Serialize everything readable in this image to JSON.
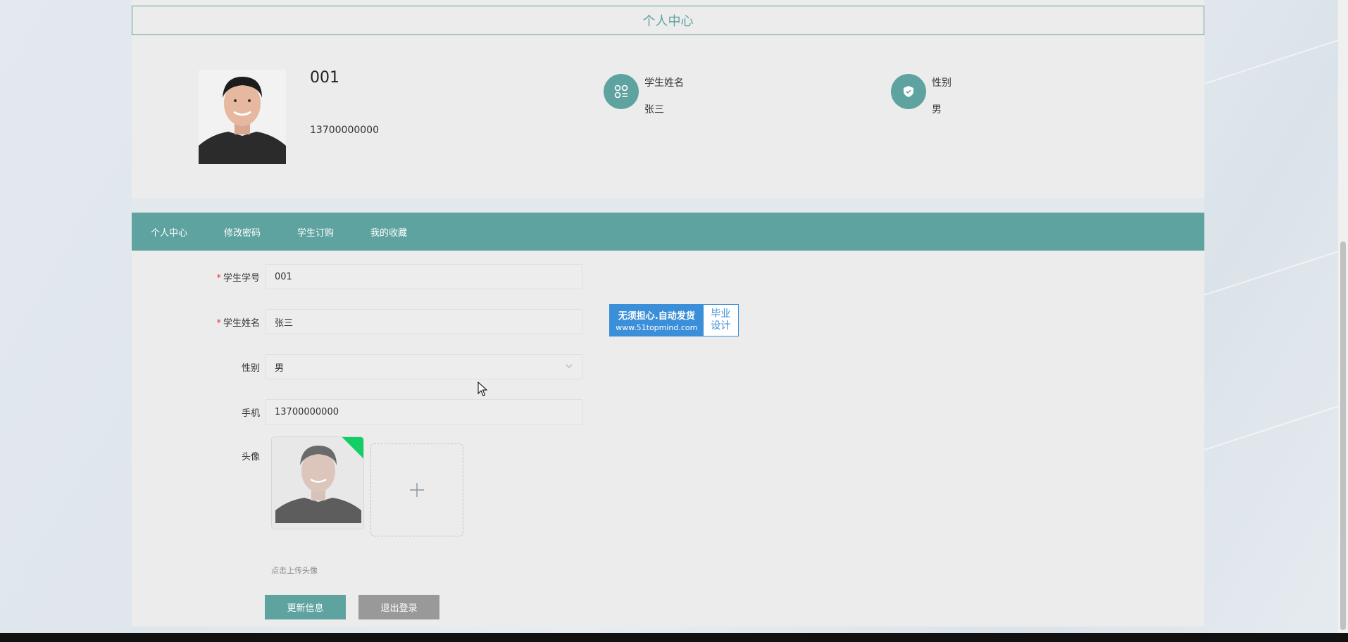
{
  "header": {
    "title": "个人中心"
  },
  "profile": {
    "username": "001",
    "phone": "13700000000",
    "name_label": "学生姓名",
    "name_value": "张三",
    "gender_label": "性别",
    "gender_value": "男"
  },
  "tabs": [
    {
      "label": "个人中心"
    },
    {
      "label": "修改密码"
    },
    {
      "label": "学生订购"
    },
    {
      "label": "我的收藏"
    }
  ],
  "form": {
    "student_id": {
      "label": "学生学号",
      "value": "001"
    },
    "student_name": {
      "label": "学生姓名",
      "value": "张三"
    },
    "gender": {
      "label": "性别",
      "value": "男"
    },
    "phone": {
      "label": "手机",
      "value": "13700000000"
    },
    "avatar": {
      "label": "头像",
      "hint": "点击上传头像"
    }
  },
  "buttons": {
    "update": "更新信息",
    "logout": "退出登录"
  },
  "ad": {
    "line1": "无须担心.自动发货",
    "line2": "www.51topmind.com",
    "right1": "毕业",
    "right2": "设计"
  },
  "colors": {
    "accent": "#5fa3a0",
    "required": "#e4393c",
    "logout_bg": "#999999",
    "ad_blue": "#3b8fd9",
    "upload_success": "#13ce66"
  }
}
